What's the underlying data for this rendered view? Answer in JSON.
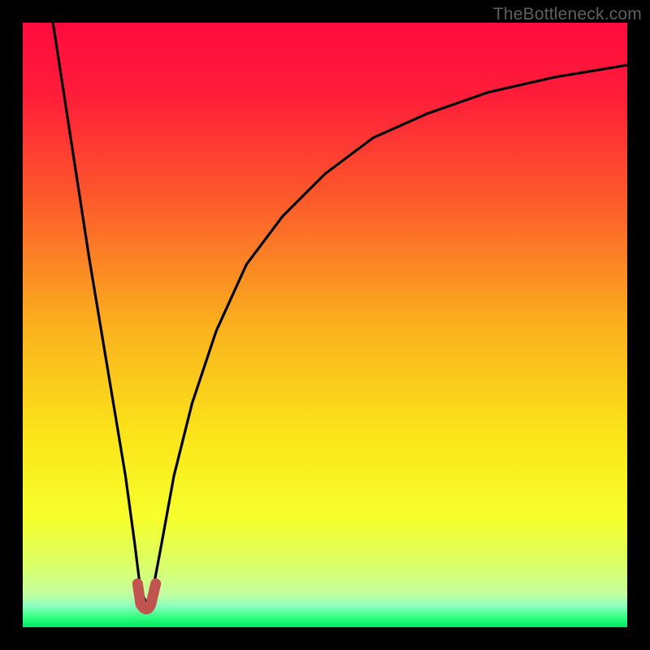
{
  "watermark": "TheBottleneck.com",
  "chart_data": {
    "type": "line",
    "title": "",
    "xlabel": "",
    "ylabel": "",
    "xlim": [
      0,
      100
    ],
    "ylim": [
      0,
      100
    ],
    "series": [
      {
        "name": "bottleneck-curve",
        "x": [
          5,
          7,
          9,
          11,
          13,
          15,
          17,
          18.5,
          19.5,
          20.5,
          21.5,
          23,
          25,
          28,
          32,
          37,
          43,
          50,
          58,
          67,
          77,
          88,
          100
        ],
        "y": [
          100,
          87,
          74,
          61,
          49,
          37,
          25,
          14,
          6,
          4,
          6,
          14,
          25,
          37,
          49,
          60,
          68,
          75,
          81,
          85,
          88.5,
          91,
          93
        ]
      },
      {
        "name": "dip-marker",
        "x": [
          19.0,
          19.5,
          20.5,
          21.2,
          22.0,
          22.0,
          19.0,
          19.0
        ],
        "y": [
          7.2,
          3.8,
          3.0,
          3.8,
          7.2,
          3.0,
          3.0,
          7.2
        ]
      }
    ],
    "gradient_stops": [
      {
        "offset": 0.0,
        "color": "#ff0b3f"
      },
      {
        "offset": 0.12,
        "color": "#ff1d39"
      },
      {
        "offset": 0.3,
        "color": "#fc5d2b"
      },
      {
        "offset": 0.5,
        "color": "#fab01d"
      },
      {
        "offset": 0.68,
        "color": "#fbe41a"
      },
      {
        "offset": 0.82,
        "color": "#f7ff2c"
      },
      {
        "offset": 0.9,
        "color": "#d9ff6a"
      },
      {
        "offset": 0.945,
        "color": "#c4ffa0"
      },
      {
        "offset": 0.965,
        "color": "#8bffc0"
      },
      {
        "offset": 0.985,
        "color": "#2bff7c"
      },
      {
        "offset": 1.0,
        "color": "#00e765"
      }
    ],
    "marker_color": "#c1544e"
  }
}
